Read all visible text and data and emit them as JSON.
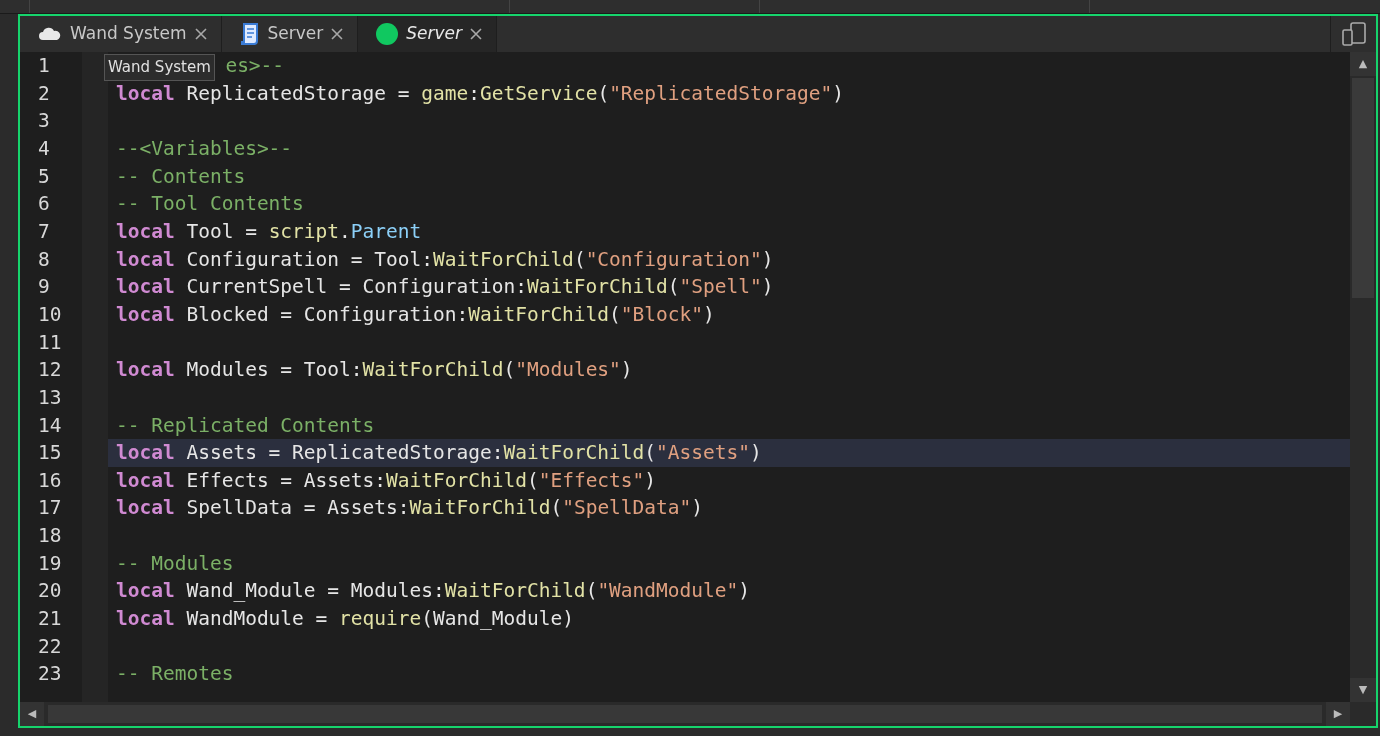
{
  "tabs": [
    {
      "label": "Wand System",
      "selected": false,
      "italic": false
    },
    {
      "label": "Server",
      "selected": false,
      "italic": false
    },
    {
      "label": "Server",
      "selected": true,
      "italic": true
    }
  ],
  "scroll_arrows": [
    "▲",
    "▼",
    "◀",
    "▶"
  ],
  "tooltip": "Wand System",
  "editor": {
    "lines": [
      {
        "number": "1",
        "cut_left": true,
        "tokens": [
          {
            "kind": "comment",
            "text": "es>--"
          }
        ]
      },
      {
        "number": "2",
        "tokens": [
          {
            "kind": "keyword",
            "text": "local"
          },
          {
            "kind": "plain",
            "text": " ReplicatedStorage = "
          },
          {
            "kind": "function",
            "text": "game"
          },
          {
            "kind": "plain",
            "text": ":"
          },
          {
            "kind": "function",
            "text": "GetService"
          },
          {
            "kind": "plain",
            "text": "("
          },
          {
            "kind": "string",
            "text": "\"ReplicatedStorage\""
          },
          {
            "kind": "plain",
            "text": ")"
          }
        ]
      },
      {
        "number": "3"
      },
      {
        "number": "4",
        "tokens": [
          {
            "kind": "comment",
            "text": "--<Variables>--"
          }
        ]
      },
      {
        "number": "5",
        "tokens": [
          {
            "kind": "comment",
            "text": "-- Contents"
          }
        ]
      },
      {
        "number": "6",
        "tokens": [
          {
            "kind": "comment",
            "text": "-- Tool Contents"
          }
        ]
      },
      {
        "number": "7",
        "tokens": [
          {
            "kind": "keyword",
            "text": "local"
          },
          {
            "kind": "plain",
            "text": " Tool = "
          },
          {
            "kind": "function",
            "text": "script"
          },
          {
            "kind": "plain",
            "text": "."
          },
          {
            "kind": "property",
            "text": "Parent"
          }
        ]
      },
      {
        "number": "8",
        "tokens": [
          {
            "kind": "keyword",
            "text": "local"
          },
          {
            "kind": "plain",
            "text": " Configuration = Tool:"
          },
          {
            "kind": "function",
            "text": "WaitForChild"
          },
          {
            "kind": "plain",
            "text": "("
          },
          {
            "kind": "string",
            "text": "\"Configuration\""
          },
          {
            "kind": "plain",
            "text": ")"
          }
        ]
      },
      {
        "number": "9",
        "tokens": [
          {
            "kind": "keyword",
            "text": "local"
          },
          {
            "kind": "plain",
            "text": " CurrentSpell = Configuration:"
          },
          {
            "kind": "function",
            "text": "WaitForChild"
          },
          {
            "kind": "plain",
            "text": "("
          },
          {
            "kind": "string",
            "text": "\"Spell\""
          },
          {
            "kind": "plain",
            "text": ")"
          }
        ]
      },
      {
        "number": "10",
        "tokens": [
          {
            "kind": "keyword",
            "text": "local"
          },
          {
            "kind": "plain",
            "text": " Blocked = Configuration:"
          },
          {
            "kind": "function",
            "text": "WaitForChild"
          },
          {
            "kind": "plain",
            "text": "("
          },
          {
            "kind": "string",
            "text": "\"Block\""
          },
          {
            "kind": "plain",
            "text": ")"
          }
        ]
      },
      {
        "number": "11"
      },
      {
        "number": "12",
        "tokens": [
          {
            "kind": "keyword",
            "text": "local"
          },
          {
            "kind": "plain",
            "text": " Modules = Tool:"
          },
          {
            "kind": "function",
            "text": "WaitForChild"
          },
          {
            "kind": "plain",
            "text": "("
          },
          {
            "kind": "string",
            "text": "\"Modules\""
          },
          {
            "kind": "plain",
            "text": ")"
          }
        ]
      },
      {
        "number": "13"
      },
      {
        "number": "14",
        "tokens": [
          {
            "kind": "comment",
            "text": "-- Replicated Contents"
          }
        ]
      },
      {
        "number": "15",
        "current": true,
        "tokens": [
          {
            "kind": "keyword",
            "text": "local"
          },
          {
            "kind": "plain",
            "text": " Assets = ReplicatedStorage:"
          },
          {
            "kind": "function",
            "text": "WaitForChild"
          },
          {
            "kind": "plain",
            "text": "("
          },
          {
            "kind": "string",
            "text": "\"Assets\""
          },
          {
            "kind": "plain",
            "text": ")"
          }
        ]
      },
      {
        "number": "16",
        "tokens": [
          {
            "kind": "keyword",
            "text": "local"
          },
          {
            "kind": "plain",
            "text": " Effects = Assets:"
          },
          {
            "kind": "function",
            "text": "WaitForChild"
          },
          {
            "kind": "plain",
            "text": "("
          },
          {
            "kind": "string",
            "text": "\"Effects\""
          },
          {
            "kind": "plain",
            "text": ")"
          }
        ]
      },
      {
        "number": "17",
        "tokens": [
          {
            "kind": "keyword",
            "text": "local"
          },
          {
            "kind": "plain",
            "text": " SpellData = Assets:"
          },
          {
            "kind": "function",
            "text": "WaitForChild"
          },
          {
            "kind": "plain",
            "text": "("
          },
          {
            "kind": "string",
            "text": "\"SpellData\""
          },
          {
            "kind": "plain",
            "text": ")"
          }
        ]
      },
      {
        "number": "18"
      },
      {
        "number": "19",
        "tokens": [
          {
            "kind": "comment",
            "text": "-- Modules"
          }
        ]
      },
      {
        "number": "20",
        "tokens": [
          {
            "kind": "keyword",
            "text": "local"
          },
          {
            "kind": "plain",
            "text": " Wand_Module = Modules:"
          },
          {
            "kind": "function",
            "text": "WaitForChild"
          },
          {
            "kind": "plain",
            "text": "("
          },
          {
            "kind": "string",
            "text": "\"WandModule\""
          },
          {
            "kind": "plain",
            "text": ")"
          }
        ]
      },
      {
        "number": "21",
        "tokens": [
          {
            "kind": "keyword",
            "text": "local"
          },
          {
            "kind": "plain",
            "text": " WandModule = "
          },
          {
            "kind": "function",
            "text": "require"
          },
          {
            "kind": "plain",
            "text": "(Wand_Module)"
          }
        ]
      },
      {
        "number": "22"
      },
      {
        "number": "23",
        "tokens": [
          {
            "kind": "comment",
            "text": "-- Remotes"
          }
        ]
      }
    ]
  }
}
